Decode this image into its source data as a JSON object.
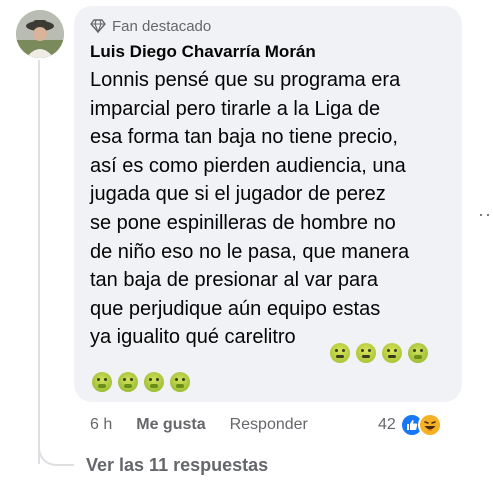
{
  "badge": {
    "label": "Fan destacado",
    "icon": "diamond-icon"
  },
  "comment": {
    "author": "Luis Diego Chavarría Morán",
    "text": "Lonnis pensé que su programa era\nimparcial pero tirarle a la Liga de\nesa forma tan baja no tiene precio,\nasí es como pierden audiencia, una\njugada que si el jugador de perez\nse pone espinilleras de hombre no\nde niño eso no le pasa, que manera\ntan baja de presionar al var para\nque perjudique aún equipo estas\nya igualito qué carelitro",
    "emojis_inline": [
      "sick-face",
      "sick-face",
      "sick-face",
      "nauseated-face"
    ],
    "emojis_second_line": [
      "nauseated-face",
      "nauseated-face",
      "nauseated-face",
      "nauseated-face"
    ]
  },
  "actions": {
    "time": "6 h",
    "like_label": "Me gusta",
    "reply_label": "Responder"
  },
  "reactions": {
    "count": "42",
    "types": [
      "like-icon",
      "haha-icon"
    ]
  },
  "view_replies": "Ver las 11 respuestas",
  "colors": {
    "bubble": "#f0f2f5",
    "secondary_text": "#65676b",
    "like_blue": "#1877f2",
    "haha_yellow": "#f7b125"
  }
}
